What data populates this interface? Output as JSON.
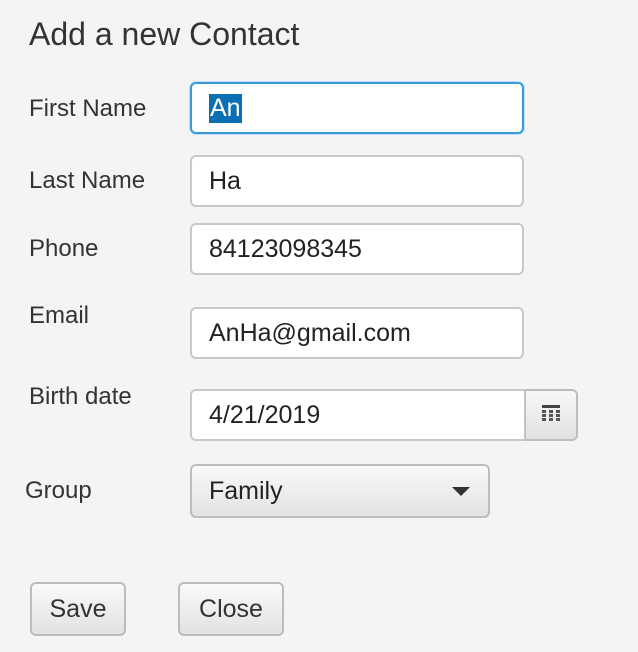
{
  "dialog": {
    "title": "Add a new Contact"
  },
  "form": {
    "first_name": {
      "label": "First Name",
      "value": "An"
    },
    "last_name": {
      "label": "Last Name",
      "value": "Ha"
    },
    "phone": {
      "label": "Phone",
      "value": "84123098345"
    },
    "email": {
      "label": "Email",
      "value": "AnHa@gmail.com"
    },
    "birth_date": {
      "label": "Birth date",
      "value": "4/21/2019",
      "picker_icon": "calendar-icon"
    },
    "group": {
      "label": "Group",
      "selected": "Family",
      "dropdown_icon": "chevron-down-icon"
    }
  },
  "buttons": {
    "save": "Save",
    "close": "Close"
  },
  "colors": {
    "background": "#f4f4f4",
    "focus_border": "#3a9ad9",
    "selection": "#0a6fb5"
  }
}
